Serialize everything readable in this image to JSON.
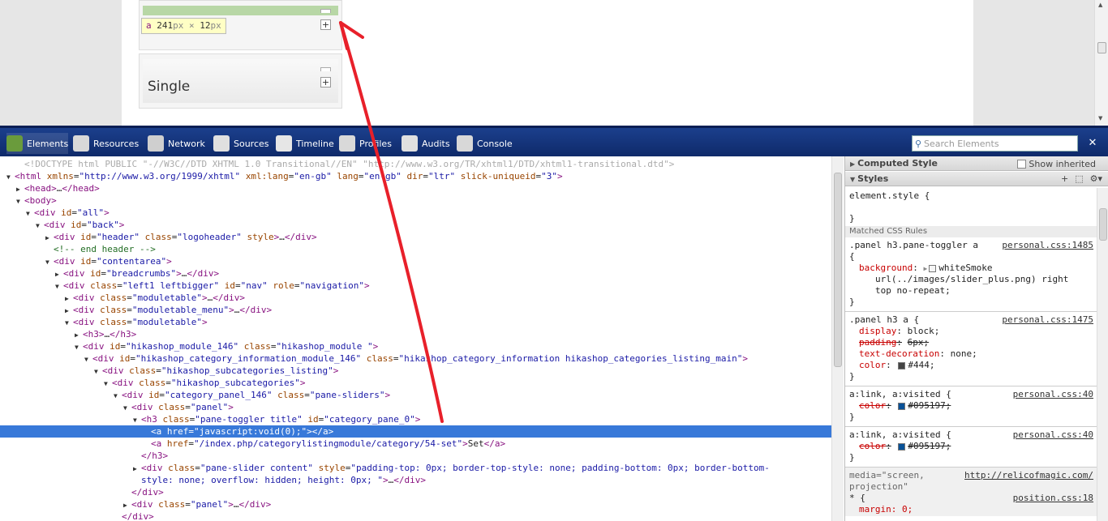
{
  "page": {
    "tooltip": {
      "tag": "a",
      "w": "241",
      "unit_w": "px",
      "x": "×",
      "h": "12",
      "unit_h": "px"
    },
    "panel_title": "Single"
  },
  "toolbar": {
    "tools": [
      {
        "label": "Elements",
        "icon": "elements-icon"
      },
      {
        "label": "Resources",
        "icon": "resources-icon"
      },
      {
        "label": "Network",
        "icon": "network-icon"
      },
      {
        "label": "Sources",
        "icon": "sources-icon"
      },
      {
        "label": "Timeline",
        "icon": "timeline-icon"
      },
      {
        "label": "Profiles",
        "icon": "profiles-icon"
      },
      {
        "label": "Audits",
        "icon": "audits-icon"
      },
      {
        "label": "Console",
        "icon": "console-icon"
      }
    ],
    "search_placeholder": "Search Elements",
    "close": "✕"
  },
  "tree": {
    "lines": [
      {
        "indent": 1,
        "tw": "",
        "html": "<span class='dt'>&lt;!DOCTYPE html PUBLIC \"-//W3C//DTD XHTML 1.0 Transitional//EN\" \"http://www.w3.org/TR/xhtml1/DTD/xhtml1-transitional.dtd\"&gt;</span>"
      },
      {
        "indent": 0,
        "tw": "▼",
        "html": "<span class='t'>&lt;html</span> <span class='a'>xmlns</span>=<span class='v'>\"http://www.w3.org/1999/xhtml\"</span> <span class='a'>xml:lang</span>=<span class='v'>\"en-gb\"</span> <span class='a'>lang</span>=<span class='v'>\"en-gb\"</span> <span class='a'>dir</span>=<span class='v'>\"ltr\"</span> <span class='a'>slick-uniqueid</span>=<span class='v'>\"3\"</span><span class='t'>&gt;</span>"
      },
      {
        "indent": 1,
        "tw": "▶",
        "html": "<span class='t'>&lt;head&gt;</span>…<span class='t'>&lt;/head&gt;</span>"
      },
      {
        "indent": 1,
        "tw": "▼",
        "html": "<span class='t'>&lt;body&gt;</span>"
      },
      {
        "indent": 2,
        "tw": "▼",
        "html": "<span class='t'>&lt;div</span> <span class='a'>id</span>=<span class='v'>\"all\"</span><span class='t'>&gt;</span>"
      },
      {
        "indent": 3,
        "tw": "▼",
        "html": "<span class='t'>&lt;div</span> <span class='a'>id</span>=<span class='v'>\"back\"</span><span class='t'>&gt;</span>"
      },
      {
        "indent": 4,
        "tw": "▶",
        "html": "<span class='t'>&lt;div</span> <span class='a'>id</span>=<span class='v'>\"header\"</span> <span class='a'>class</span>=<span class='v'>\"logoheader\"</span> <span class='a'>style</span><span class='t'>&gt;</span>…<span class='t'>&lt;/div&gt;</span>"
      },
      {
        "indent": 4,
        "tw": "",
        "html": "<span class='cm'>&lt;!-- end header --&gt;</span>"
      },
      {
        "indent": 4,
        "tw": "▼",
        "html": "<span class='t'>&lt;div</span> <span class='a'>id</span>=<span class='v'>\"contentarea\"</span><span class='t'>&gt;</span>"
      },
      {
        "indent": 5,
        "tw": "▶",
        "html": "<span class='t'>&lt;div</span> <span class='a'>id</span>=<span class='v'>\"breadcrumbs\"</span><span class='t'>&gt;</span>…<span class='t'>&lt;/div&gt;</span>"
      },
      {
        "indent": 5,
        "tw": "▼",
        "html": "<span class='t'>&lt;div</span> <span class='a'>class</span>=<span class='v'>\"left1 leftbigger\"</span> <span class='a'>id</span>=<span class='v'>\"nav\"</span> <span class='a'>role</span>=<span class='v'>\"navigation\"</span><span class='t'>&gt;</span>"
      },
      {
        "indent": 6,
        "tw": "▶",
        "html": "<span class='t'>&lt;div</span> <span class='a'>class</span>=<span class='v'>\"moduletable\"</span><span class='t'>&gt;</span>…<span class='t'>&lt;/div&gt;</span>"
      },
      {
        "indent": 6,
        "tw": "▶",
        "html": "<span class='t'>&lt;div</span> <span class='a'>class</span>=<span class='v'>\"moduletable_menu\"</span><span class='t'>&gt;</span>…<span class='t'>&lt;/div&gt;</span>"
      },
      {
        "indent": 6,
        "tw": "▼",
        "html": "<span class='t'>&lt;div</span> <span class='a'>class</span>=<span class='v'>\"moduletable\"</span><span class='t'>&gt;</span>"
      },
      {
        "indent": 7,
        "tw": "▶",
        "html": "<span class='t'>&lt;h3&gt;</span>…<span class='t'>&lt;/h3&gt;</span>"
      },
      {
        "indent": 7,
        "tw": "▼",
        "html": "<span class='t'>&lt;div</span> <span class='a'>id</span>=<span class='v'>\"hikashop_module_146\"</span> <span class='a'>class</span>=<span class='v'>\"hikashop_module \"</span><span class='t'>&gt;</span>"
      },
      {
        "indent": 8,
        "tw": "▼",
        "html": "<span class='t'>&lt;div</span> <span class='a'>id</span>=<span class='v'>\"hikashop_category_information_module_146\"</span> <span class='a'>class</span>=<span class='v'>\"hikashop_category_information hikashop_categories_listing_main\"</span><span class='t'>&gt;</span>"
      },
      {
        "indent": 9,
        "tw": "▼",
        "html": "<span class='t'>&lt;div</span> <span class='a'>class</span>=<span class='v'>\"hikashop_subcategories_listing\"</span><span class='t'>&gt;</span>"
      },
      {
        "indent": 10,
        "tw": "▼",
        "html": "<span class='t'>&lt;div</span> <span class='a'>class</span>=<span class='v'>\"hikashop_subcategories\"</span><span class='t'>&gt;</span>"
      },
      {
        "indent": 11,
        "tw": "▼",
        "html": "<span class='t'>&lt;div</span> <span class='a'>id</span>=<span class='v'>\"category_panel_146\"</span> <span class='a'>class</span>=<span class='v'>\"pane-sliders\"</span><span class='t'>&gt;</span>"
      },
      {
        "indent": 12,
        "tw": "▼",
        "html": "<span class='t'>&lt;div</span> <span class='a'>class</span>=<span class='v'>\"panel\"</span><span class='t'>&gt;</span>"
      },
      {
        "indent": 13,
        "tw": "▼",
        "html": "<span class='t'>&lt;h3</span> <span class='a'>class</span>=<span class='v'>\"pane-toggler title\"</span> <span class='a'>id</span>=<span class='v'>\"category_pane_0\"</span><span class='t'>&gt;</span>"
      },
      {
        "indent": 14,
        "tw": "",
        "sel": true,
        "html": "<span class='t'>&lt;a</span> <span class='a'>href</span>=<span class='v'>\"javascript:void(0);\"</span><span class='t'>&gt;&lt;/a&gt;</span>"
      },
      {
        "indent": 14,
        "tw": "",
        "html": "<span class='t'>&lt;a</span> <span class='a'>href</span>=<span class='v'>\"/index.php/categorylistingmodule/category/54-set\"</span><span class='t'>&gt;</span>Set<span class='t'>&lt;/a&gt;</span>"
      },
      {
        "indent": 13,
        "tw": "",
        "html": "<span class='t'>&lt;/h3&gt;</span>"
      },
      {
        "indent": 13,
        "tw": "▶",
        "html": "<span class='t'>&lt;div</span> <span class='a'>class</span>=<span class='v'>\"pane-slider content\"</span> <span class='a'>style</span>=<span class='v'>\"padding-top: 0px; border-top-style: none; padding-bottom: 0px; border-bottom-</span>"
      },
      {
        "indent": 13,
        "tw": "",
        "html": "<span class='v'>style: none; overflow: hidden; height: 0px; \"</span><span class='t'>&gt;</span>…<span class='t'>&lt;/div&gt;</span>"
      },
      {
        "indent": 12,
        "tw": "",
        "html": "<span class='t'>&lt;/div&gt;</span>"
      },
      {
        "indent": 12,
        "tw": "▶",
        "html": "<span class='t'>&lt;div</span> <span class='a'>class</span>=<span class='v'>\"panel\"</span><span class='t'>&gt;</span>…<span class='t'>&lt;/div&gt;</span>"
      },
      {
        "indent": 11,
        "tw": "",
        "html": "<span class='t'>&lt;/div&gt;</span>"
      }
    ]
  },
  "sidebar": {
    "computed_style": "Computed Style",
    "show_inherited": "Show inherited",
    "styles": "Styles",
    "matched_rules": "Matched CSS Rules",
    "element_style": "element.style {",
    "close_brace": "}",
    "rules": [
      {
        "selector": ".panel h3.pane-toggler a",
        "source": "personal.css:1485",
        "open": "{",
        "props": [
          {
            "name": "background",
            "value": "whiteSmoke",
            "swatch": "#f5f5f5",
            "expand": true
          },
          {
            "cont": "url(../images/slider_plus.png) right"
          },
          {
            "cont": "top no-repeat;"
          }
        ]
      },
      {
        "selector": ".panel h3 a {",
        "source": "personal.css:1475",
        "props": [
          {
            "name": "display",
            "value": "block;"
          },
          {
            "name": "padding",
            "value": "6px;",
            "struck": true
          },
          {
            "name": "text-decoration",
            "value": "none;"
          },
          {
            "name": "color",
            "value": "#444;",
            "swatch": "#444444"
          }
        ]
      },
      {
        "selector": "a:link, a:visited {",
        "source": "personal.css:40",
        "props": [
          {
            "name": "color",
            "value": "#095197;",
            "swatch": "#095197",
            "struck": true
          }
        ]
      },
      {
        "selector": "a:link, a:visited {",
        "source": "personal.css:40",
        "props": [
          {
            "name": "color",
            "value": "#095197;",
            "swatch": "#095197",
            "struck": true
          }
        ]
      }
    ],
    "media": {
      "label": "media=\"screen,",
      "label2": "projection\"",
      "link": "http://relicofmagic.com/"
    },
    "last_rule": {
      "selector": "* {",
      "source": "position.css:18",
      "prop": "margin: 0;"
    }
  },
  "colors": {
    "accent": "#3879d9",
    "toolbar": "#1b3f8c",
    "annotation": "#e8202a"
  }
}
